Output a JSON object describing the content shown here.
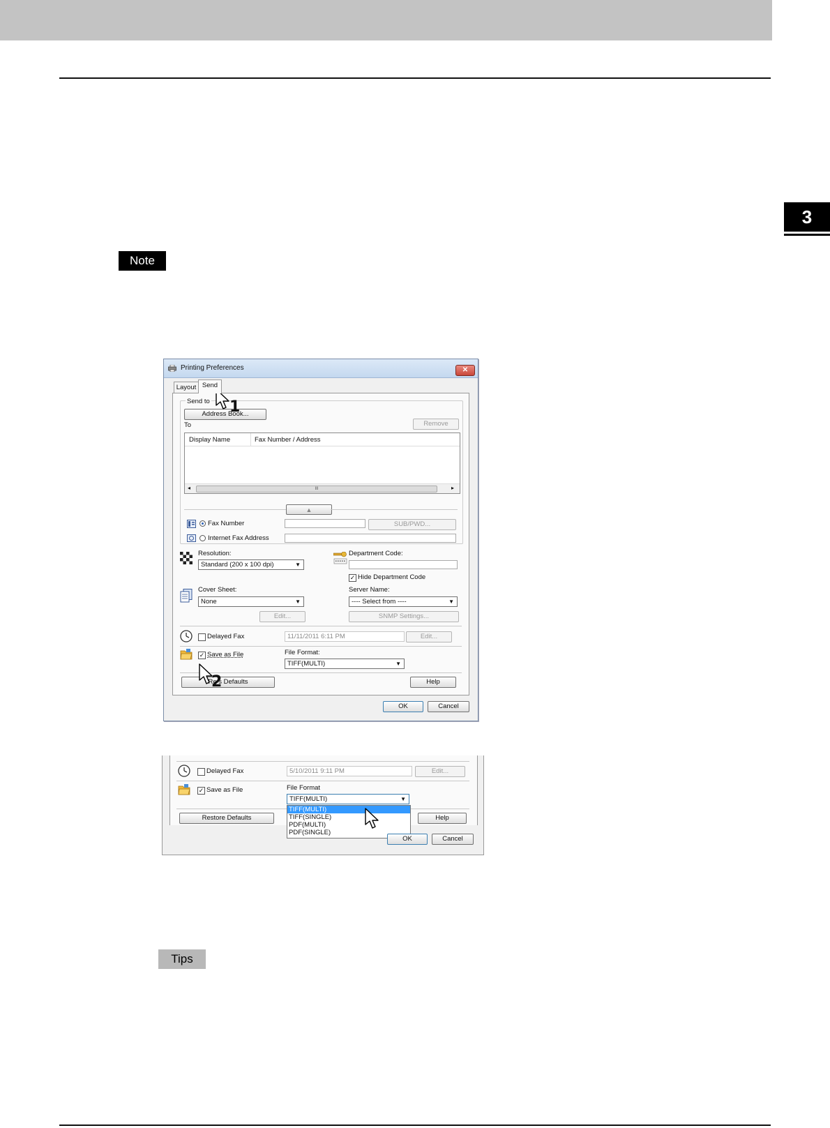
{
  "page": {
    "chapter_number": "3",
    "note_label": "Note",
    "tips_label": "Tips"
  },
  "dialog1": {
    "title": "Printing Preferences",
    "close_symbol": "✕",
    "tabs": [
      {
        "label": "Layout"
      },
      {
        "label": "Send"
      }
    ],
    "send_to_label": "Send to",
    "address_book_button": "Address Book...",
    "to_label": "To",
    "remove_button": "Remove",
    "columns": [
      "Display Name",
      "Fax Number / Address"
    ],
    "scroll_thumb_glyph": "III",
    "fax_number_label": "Fax Number",
    "sub_pwd_button": "SUB/PWD...",
    "internet_fax_label": "Internet Fax Address",
    "resolution_label": "Resolution:",
    "resolution_value": "Standard (200 x 100 dpi)",
    "department_code_label": "Department Code:",
    "hide_department_code_label": "Hide Department Code",
    "cover_sheet_label": "Cover Sheet:",
    "cover_sheet_value": "None",
    "cover_edit_button": "Edit...",
    "server_name_label": "Server Name:",
    "server_name_value": "---- Select from ----",
    "snmp_button": "SNMP Settings...",
    "delayed_fax_label": "Delayed Fax",
    "delayed_fax_value": "11/11/2011 6:11 PM",
    "delayed_edit_button": "Edit...",
    "save_as_file_label": "Save as File",
    "file_format_label": "File Format:",
    "file_format_value": "TIFF(MULTI)",
    "restore_defaults_button": "Re   s Defaults",
    "help_button": "Help",
    "ok_button": "OK",
    "cancel_button": "Cancel",
    "step1": "1",
    "step2": "2"
  },
  "dialog2": {
    "delayed_fax_label": "Delayed Fax",
    "delayed_fax_value": "5/10/2011 9:11 PM",
    "edit_button": "Edit...",
    "save_as_file_label": "Save as File",
    "file_format_label": "File Format",
    "file_format_value": "TIFF(MULTI)",
    "options": [
      "TIFF(MULTI)",
      "TIFF(SINGLE)",
      "PDF(MULTI)",
      "PDF(SINGLE)"
    ],
    "restore_defaults_button": "Restore Defaults",
    "help_button": "Help",
    "ok_button": "OK",
    "cancel_button": "Cancel"
  },
  "colors": {
    "header_gray": "#c3c3c3",
    "note_bg": "#000000",
    "tips_bg": "#b8b8b8",
    "selection_blue": "#3399ff"
  }
}
